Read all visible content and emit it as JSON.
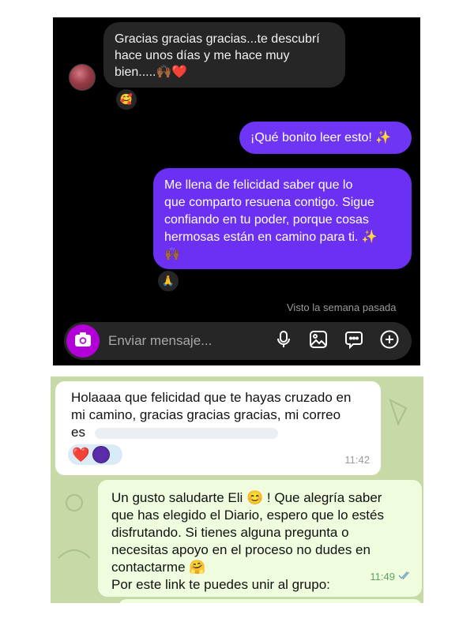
{
  "instagram": {
    "incoming": {
      "lines": [
        "Gracias gracias gracias...te descubrí",
        "hace unos días y me hace muy",
        "bien.....🙌🏾❤️"
      ],
      "reaction": "🥰"
    },
    "outgoing_short": "¡Qué bonito leer esto! ✨",
    "outgoing_long": {
      "lines": [
        "Me llena de felicidad saber que lo",
        "que comparto resuena contigo. Sigue",
        "confiando en tu poder, porque cosas",
        "hermosas están en camino para ti. ✨",
        "🙌🏾"
      ],
      "reaction": "🙏"
    },
    "seen_label": "Visto la semana pasada",
    "composer": {
      "placeholder": "Enviar mensaje...",
      "icons": [
        "camera-icon",
        "microphone-icon",
        "image-icon",
        "sticker-icon",
        "plus-icon"
      ]
    }
  },
  "whatsapp": {
    "incoming": {
      "lines": [
        "Holaaaa que felicidad que te hayas cruzado en",
        "mi camino, gracias gracias gracias, mi correo",
        "es"
      ],
      "reactions": [
        "❤️",
        "purple-circle"
      ],
      "time": "11:42"
    },
    "outgoing": {
      "lines": [
        "Un gusto saludarte Eli 😊 ! Que alegría saber",
        "que has elegido el Diario, espero que lo estés",
        "disfrutando. Si tienes alguna pregunta o",
        "necesitas apoyo en el proceso no dudes en",
        "contactarme 🤗",
        "Por este link te puedes unir al grupo:"
      ],
      "time": "11:49",
      "status": "double-check-icon"
    }
  }
}
